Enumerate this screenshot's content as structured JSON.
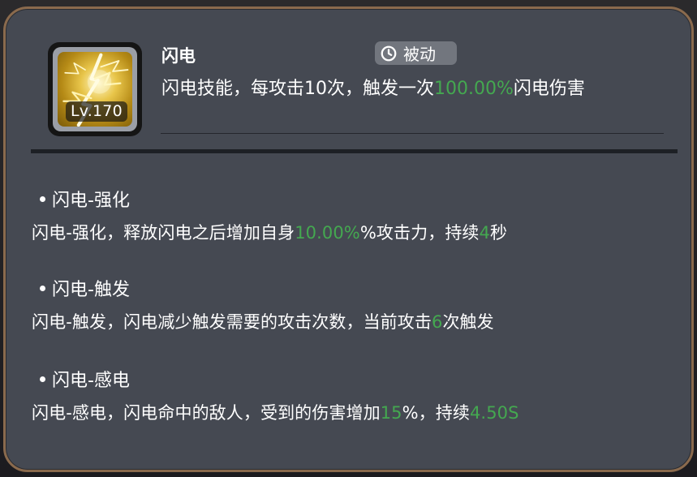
{
  "skill": {
    "name": "闪电",
    "level_label": "Lv.170",
    "type_label": "被动",
    "description": {
      "prefix": "闪电技能，每攻击10次，触发一次",
      "value": "100.00%",
      "suffix": "闪电伤害"
    }
  },
  "sections": [
    {
      "title": "闪电-强化",
      "desc_a": "闪电-强化，释放闪电之后增加自身",
      "value_1": "10.00%",
      "desc_b": "%攻击力，持续",
      "value_2": "4",
      "desc_c": "秒"
    },
    {
      "title": "闪电-触发",
      "desc_a": "闪电-触发，闪电减少触发需要的攻击次数，当前攻击",
      "value_1": "6",
      "desc_b": "次触发"
    },
    {
      "title": "闪电-感电",
      "desc_a": "闪电-感电，闪电命中的敌人，受到的伤害增加",
      "value_1": "15",
      "desc_b": "%，持续",
      "value_2": "4.50S"
    }
  ],
  "colors": {
    "highlight": "#44a850",
    "panel_background": "#454952",
    "panel_border": "#8a6a4d"
  },
  "icons": {
    "skill_icon": "lightning-icon",
    "type_icon": "clock-icon"
  }
}
